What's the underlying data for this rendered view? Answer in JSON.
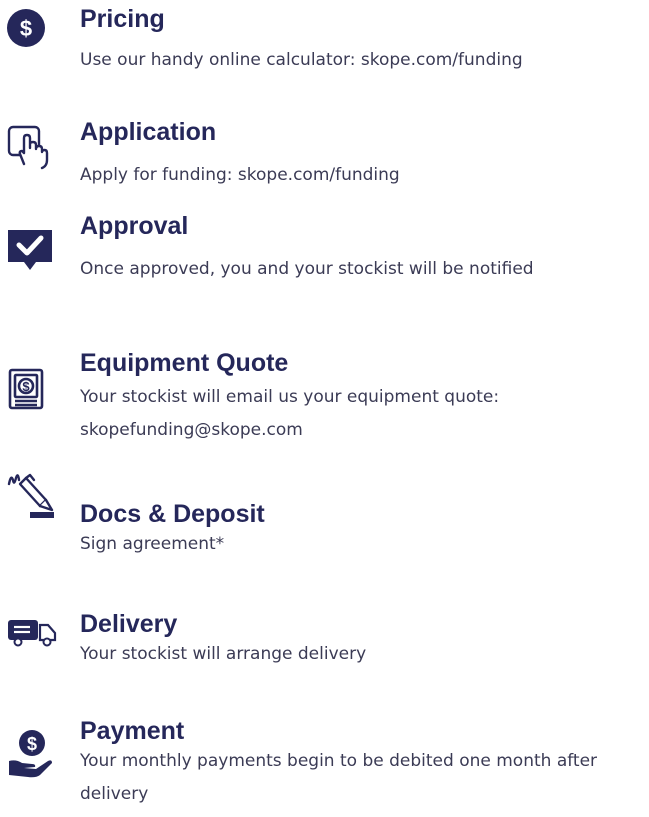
{
  "colors": {
    "brand_navy": "#25275a",
    "icon_navy": "#25275a",
    "text": "#3b3b55"
  },
  "steps": [
    {
      "icon": "dollar-circle-icon",
      "title": "Pricing",
      "description": "Use our handy online calculator: skope.com/funding"
    },
    {
      "icon": "hand-tap-icon",
      "title": "Application",
      "description": "Apply for funding: skope.com/funding"
    },
    {
      "icon": "checkmark-badge-icon",
      "title": "Approval",
      "description": "Once approved, you and your stockist will be notified"
    },
    {
      "icon": "quote-document-icon",
      "title": "Equipment Quote",
      "description": "Your stockist will email us your equipment quote: skopefunding@skope.com"
    },
    {
      "icon": "pen-sign-icon",
      "title": "Docs & Deposit",
      "description": "Sign agreement*"
    },
    {
      "icon": "delivery-truck-icon",
      "title": "Delivery",
      "description": "Your stockist will arrange delivery"
    },
    {
      "icon": "hand-coin-icon",
      "title": "Payment",
      "description": "Your monthly payments begin to be debited one month after delivery"
    }
  ]
}
